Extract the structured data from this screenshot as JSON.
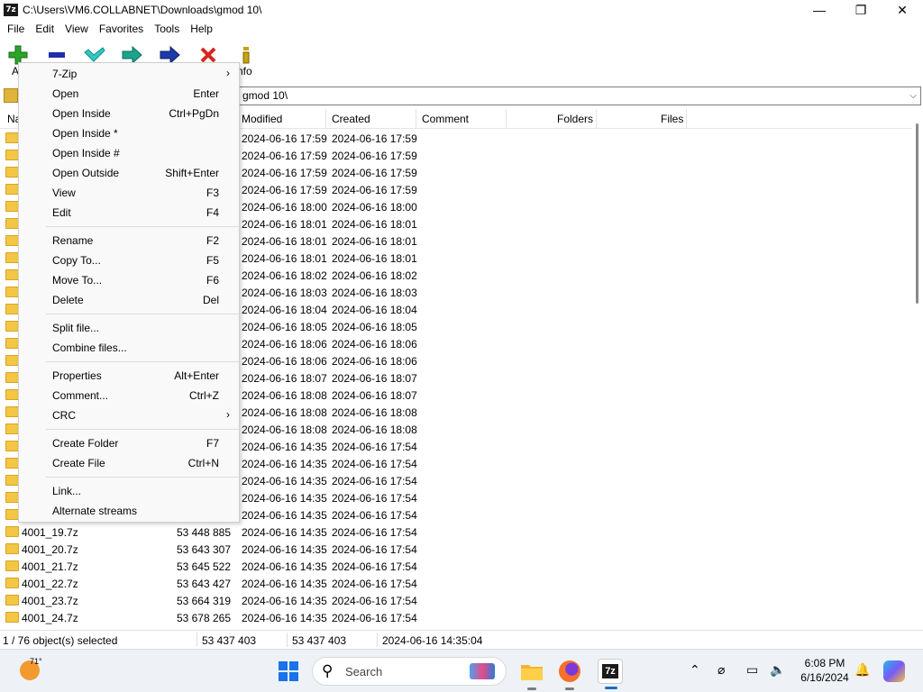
{
  "window": {
    "title": "C:\\Users\\VM6.COLLABNET\\Downloads\\gmod 10\\",
    "app_icon": "7z",
    "controls": {
      "minimize": "—",
      "maximize": "❐",
      "close": "✕"
    }
  },
  "menubar": [
    "File",
    "Edit",
    "View",
    "Favorites",
    "Tools",
    "Help"
  ],
  "toolbar": {
    "add_label": "Ac",
    "info_label": "nfo",
    "buttons": [
      {
        "icon": "add-icon",
        "color": "#2aa52a"
      },
      {
        "icon": "extract-icon",
        "color": "#1c2fa8"
      },
      {
        "icon": "test-icon",
        "color": "#2fc9c4"
      },
      {
        "icon": "copy-icon",
        "color": "#1aa58a"
      },
      {
        "icon": "move-icon",
        "color": "#1c3aa8"
      },
      {
        "icon": "delete-icon",
        "color": "#d9261c"
      },
      {
        "icon": "info-icon",
        "color": "#c7a20b"
      }
    ]
  },
  "address": {
    "path": "gmod 10\\"
  },
  "columns": {
    "name": "Na",
    "modified": "Modified",
    "created": "Created",
    "comment": "Comment",
    "folders": "Folders",
    "files": "Files"
  },
  "rows": [
    {
      "name": "",
      "size": "",
      "modified": "2024-06-16 17:59",
      "created": "2024-06-16 17:59"
    },
    {
      "name": "",
      "size": "",
      "modified": "2024-06-16 17:59",
      "created": "2024-06-16 17:59"
    },
    {
      "name": "",
      "size": "",
      "modified": "2024-06-16 17:59",
      "created": "2024-06-16 17:59"
    },
    {
      "name": "",
      "size": "",
      "modified": "2024-06-16 17:59",
      "created": "2024-06-16 17:59"
    },
    {
      "name": "",
      "size": "",
      "modified": "2024-06-16 18:00",
      "created": "2024-06-16 18:00"
    },
    {
      "name": "",
      "size": "",
      "modified": "2024-06-16 18:01",
      "created": "2024-06-16 18:01"
    },
    {
      "name": "",
      "size": "",
      "modified": "2024-06-16 18:01",
      "created": "2024-06-16 18:01"
    },
    {
      "name": "",
      "size": "",
      "modified": "2024-06-16 18:01",
      "created": "2024-06-16 18:01"
    },
    {
      "name": "",
      "size": "",
      "modified": "2024-06-16 18:02",
      "created": "2024-06-16 18:02"
    },
    {
      "name": "",
      "size": "",
      "modified": "2024-06-16 18:03",
      "created": "2024-06-16 18:03"
    },
    {
      "name": "",
      "size": "",
      "modified": "2024-06-16 18:04",
      "created": "2024-06-16 18:04"
    },
    {
      "name": "",
      "size": "",
      "modified": "2024-06-16 18:05",
      "created": "2024-06-16 18:05"
    },
    {
      "name": "",
      "size": "",
      "modified": "2024-06-16 18:06",
      "created": "2024-06-16 18:06"
    },
    {
      "name": "",
      "size": "",
      "modified": "2024-06-16 18:06",
      "created": "2024-06-16 18:06"
    },
    {
      "name": "",
      "size": "",
      "modified": "2024-06-16 18:07",
      "created": "2024-06-16 18:07"
    },
    {
      "name": "",
      "size": "",
      "modified": "2024-06-16 18:08",
      "created": "2024-06-16 18:07"
    },
    {
      "name": "",
      "size": "",
      "modified": "2024-06-16 18:08",
      "created": "2024-06-16 18:08"
    },
    {
      "name": "",
      "size": "",
      "modified": "2024-06-16 18:08",
      "created": "2024-06-16 18:08"
    },
    {
      "name": "",
      "size": "",
      "modified": "2024-06-16 14:35",
      "created": "2024-06-16 17:54"
    },
    {
      "name": "",
      "size": "",
      "modified": "2024-06-16 14:35",
      "created": "2024-06-16 17:54"
    },
    {
      "name": "",
      "size": "",
      "modified": "2024-06-16 14:35",
      "created": "2024-06-16 17:54"
    },
    {
      "name": "",
      "size": "",
      "modified": "2024-06-16 14:35",
      "created": "2024-06-16 17:54"
    },
    {
      "name": "",
      "size": "",
      "modified": "2024-06-16 14:35",
      "created": "2024-06-16 17:54"
    },
    {
      "name": "4001_19.7z",
      "size": "53 448 885",
      "modified": "2024-06-16 14:35",
      "created": "2024-06-16 17:54"
    },
    {
      "name": "4001_20.7z",
      "size": "53 643 307",
      "modified": "2024-06-16 14:35",
      "created": "2024-06-16 17:54"
    },
    {
      "name": "4001_21.7z",
      "size": "53 645 522",
      "modified": "2024-06-16 14:35",
      "created": "2024-06-16 17:54"
    },
    {
      "name": "4001_22.7z",
      "size": "53 643 427",
      "modified": "2024-06-16 14:35",
      "created": "2024-06-16 17:54"
    },
    {
      "name": "4001_23.7z",
      "size": "53 664 319",
      "modified": "2024-06-16 14:35",
      "created": "2024-06-16 17:54"
    },
    {
      "name": "4001_24.7z",
      "size": "53 678 265",
      "modified": "2024-06-16 14:35",
      "created": "2024-06-16 17:54"
    }
  ],
  "status": {
    "selected": "1 / 76 object(s) selected",
    "size1": "53 437 403",
    "size2": "53 437 403",
    "datetime": "2024-06-16 14:35:04"
  },
  "context_menu": [
    {
      "label": "7-Zip",
      "shortcut": "",
      "submenu": true
    },
    {
      "label": "Open",
      "shortcut": "Enter"
    },
    {
      "label": "Open Inside",
      "shortcut": "Ctrl+PgDn"
    },
    {
      "label": "Open Inside *",
      "shortcut": ""
    },
    {
      "label": "Open Inside #",
      "shortcut": ""
    },
    {
      "label": "Open Outside",
      "shortcut": "Shift+Enter"
    },
    {
      "label": "View",
      "shortcut": "F3"
    },
    {
      "label": "Edit",
      "shortcut": "F4"
    },
    {
      "separator": true
    },
    {
      "label": "Rename",
      "shortcut": "F2"
    },
    {
      "label": "Copy To...",
      "shortcut": "F5"
    },
    {
      "label": "Move To...",
      "shortcut": "F6"
    },
    {
      "label": "Delete",
      "shortcut": "Del"
    },
    {
      "separator": true
    },
    {
      "label": "Split file...",
      "shortcut": ""
    },
    {
      "label": "Combine files...",
      "shortcut": ""
    },
    {
      "separator": true
    },
    {
      "label": "Properties",
      "shortcut": "Alt+Enter"
    },
    {
      "label": "Comment...",
      "shortcut": "Ctrl+Z"
    },
    {
      "label": "CRC",
      "shortcut": "",
      "submenu": true
    },
    {
      "separator": true
    },
    {
      "label": "Create Folder",
      "shortcut": "F7"
    },
    {
      "label": "Create File",
      "shortcut": "Ctrl+N"
    },
    {
      "separator": true
    },
    {
      "label": "Link...",
      "shortcut": ""
    },
    {
      "label": "Alternate streams",
      "shortcut": ""
    }
  ],
  "taskbar": {
    "temperature": "71°",
    "search_placeholder": "Search",
    "time": "6:08 PM",
    "date": "6/16/2024",
    "apps": [
      {
        "name": "file-explorer",
        "text": ""
      },
      {
        "name": "firefox",
        "text": ""
      },
      {
        "name": "7zip",
        "text": "7z"
      }
    ]
  }
}
